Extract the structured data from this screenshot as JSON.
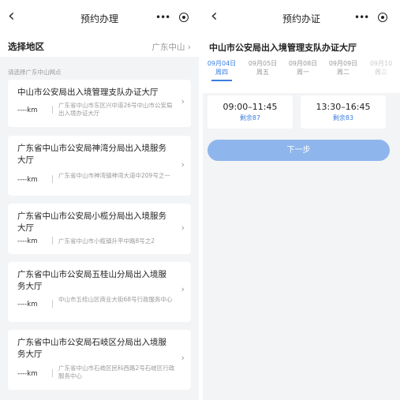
{
  "left": {
    "nav": {
      "back_glyph": "‹",
      "title": "预约办理"
    },
    "region": {
      "label": "选择地区",
      "value": "广东中山 ›"
    },
    "hint": "请选择广东中山网点",
    "offices": [
      {
        "name": "中山市公安局出入境管理支队办证大厅",
        "km": "----km",
        "address": "广东省中山市东区兴中道26号中山市公安局出入境办证大厅"
      },
      {
        "name": "广东省中山市公安局神湾分局出入境服务大厅",
        "km": "----km",
        "address": "广东省中山市神湾镇神湾大道中209号之一"
      },
      {
        "name": "广东省中山市公安局小榄分局出入境服务大厅",
        "km": "----km",
        "address": "广东省中山市小榄镇升平中路8号之2"
      },
      {
        "name": "广东省中山市公安局五桂山分局出入境服务大厅",
        "km": "----km",
        "address": "中山市五桂山区商业大街68号行政服务中心"
      },
      {
        "name": "广东省中山市公安局石岐区分局出入境服务大厅",
        "km": "----km",
        "address": "广东省中山市石岐区民科西路2号石岐区行政服务中心"
      }
    ],
    "arrow_glyph": "›"
  },
  "right": {
    "nav": {
      "back_glyph": "‹",
      "title": "预约办证"
    },
    "unit": "中山市公安局出入境管理支队办证大厅",
    "dates": [
      {
        "date": "09月04日",
        "weekday": "周四"
      },
      {
        "date": "09月05日",
        "weekday": "周五"
      },
      {
        "date": "09月08日",
        "weekday": "周一"
      },
      {
        "date": "09月09日",
        "weekday": "周二"
      },
      {
        "date": "09月10",
        "weekday": "周三"
      }
    ],
    "slots": [
      {
        "time": "09:00–11:45",
        "remaining": "剩余87"
      },
      {
        "time": "13:30–16:45",
        "remaining": "剩余83"
      }
    ],
    "next_label": "下一步"
  },
  "capsule": {
    "dots": "•••"
  },
  "colors": {
    "accent": "#3a7de0",
    "button": "#8fb6ec",
    "background": "#f3f4f6"
  }
}
